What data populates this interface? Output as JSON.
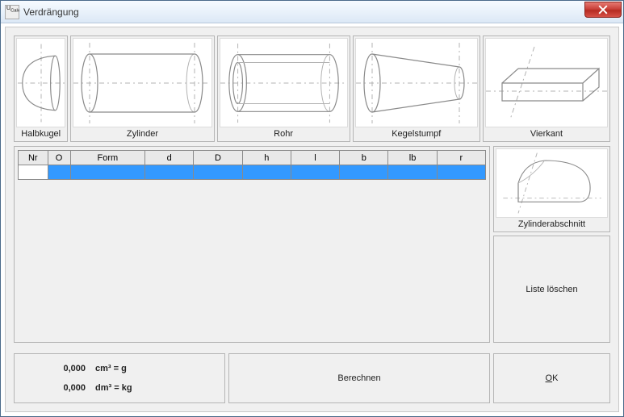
{
  "window": {
    "title": "Verdrängung"
  },
  "shapes": {
    "halbkugel": {
      "label": "Halbkugel"
    },
    "zylinder": {
      "label": "Zylinder"
    },
    "rohr": {
      "label": "Rohr"
    },
    "kegelstumpf": {
      "label": "Kegelstumpf"
    },
    "vierkant": {
      "label": "Vierkant"
    },
    "zylinderabschnitt": {
      "label": "Zylinderabschnitt"
    }
  },
  "grid": {
    "headers": {
      "nr": "Nr",
      "o": "O",
      "form": "Form",
      "d": "d",
      "D": "D",
      "h": "h",
      "l": "l",
      "b": "b",
      "lb": "lb",
      "r": "r"
    },
    "rows": [
      {
        "nr": "",
        "o": "",
        "form": "",
        "d": "",
        "D": "",
        "h": "",
        "l": "",
        "b": "",
        "lb": "",
        "r": ""
      }
    ]
  },
  "buttons": {
    "liste_loeschen": "Liste löschen",
    "berechnen": "Berechnen",
    "ok_prefix": "O",
    "ok_suffix": "K"
  },
  "results": {
    "cm3_value": "0,000",
    "cm3_unit": "cm³  =  g",
    "dm3_value": "0,000",
    "dm3_unit": "dm³  =  kg"
  }
}
